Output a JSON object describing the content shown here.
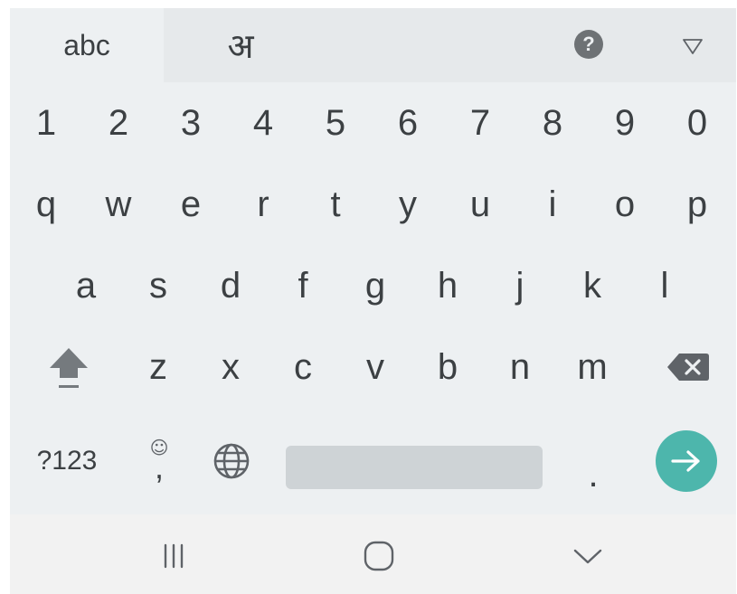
{
  "colors": {
    "keyboard_bg": "#edf0f2",
    "topbar_bg": "#e6e9eb",
    "key_text": "#3c4043",
    "space_bar": "#ced3d6",
    "enter_accent": "#4db6ac",
    "navbar_bg": "#f2f2f2"
  },
  "topbar": {
    "tabs": [
      {
        "label": "abc",
        "active": true
      },
      {
        "label": "अ",
        "active": false
      }
    ],
    "help_label": "?",
    "help_icon": "question-circle-icon",
    "collapse_icon": "triangle-down-icon"
  },
  "rows": {
    "numbers": [
      "1",
      "2",
      "3",
      "4",
      "5",
      "6",
      "7",
      "8",
      "9",
      "0"
    ],
    "top": [
      "q",
      "w",
      "e",
      "r",
      "t",
      "y",
      "u",
      "i",
      "o",
      "p"
    ],
    "middle": [
      "a",
      "s",
      "d",
      "f",
      "g",
      "h",
      "j",
      "k",
      "l"
    ],
    "bottom": [
      "z",
      "x",
      "c",
      "v",
      "b",
      "n",
      "m"
    ]
  },
  "special": {
    "shift_icon": "shift-arrow-icon",
    "backspace_icon": "backspace-icon",
    "symbols_label": "?123",
    "emoji_glyph": "☺",
    "comma_label": ",",
    "globe_icon": "globe-icon",
    "period_label": ".",
    "enter_icon": "arrow-right-icon"
  },
  "navbar": {
    "recents_icon": "recent-apps-icon",
    "home_icon": "home-icon",
    "back_icon": "chevron-down-icon"
  }
}
